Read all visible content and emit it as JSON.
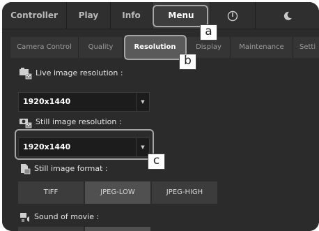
{
  "top_tabs": [
    {
      "label": "Controller"
    },
    {
      "label": "Play"
    },
    {
      "label": "Info"
    },
    {
      "label": "Menu",
      "active": true
    },
    {
      "icon": "power-icon"
    },
    {
      "icon": "moon-icon"
    }
  ],
  "sub_tabs": [
    {
      "label": "Camera Control"
    },
    {
      "label": "Quality"
    },
    {
      "label": "Resolution",
      "active": true
    },
    {
      "label": "Display"
    },
    {
      "label": "Maintenance"
    },
    {
      "label": "Setti"
    }
  ],
  "live_resolution": {
    "label": "Live image resolution :",
    "value": "1920x1440",
    "icon": "live-camera-icon"
  },
  "still_resolution": {
    "label": "Still image resolution :",
    "value": "1920x1440",
    "icon": "still-camera-icon"
  },
  "still_format": {
    "label": "Still image format :",
    "icon": "file-format-icon",
    "options": [
      "TIFF",
      "JPEG-LOW",
      "JPEG-HIGH"
    ],
    "selected": "JPEG-LOW"
  },
  "sound_of_movie": {
    "label": "Sound of movie :",
    "icon": "movie-sound-icon"
  },
  "callouts": {
    "a": "a",
    "b": "b",
    "c": "c"
  },
  "colors": {
    "background": "#2b2b2b",
    "active_tab": "#3d3d3d",
    "highlight": "#a6a6a6"
  }
}
